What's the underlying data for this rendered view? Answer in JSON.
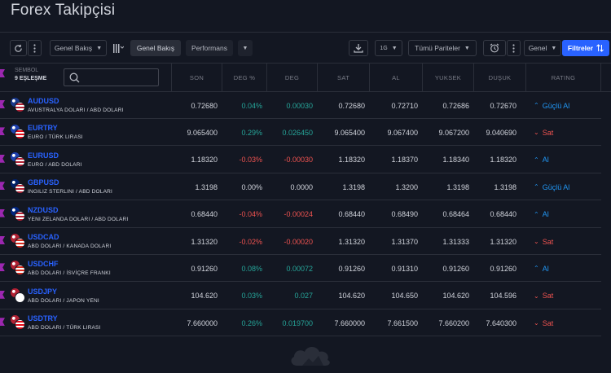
{
  "title": "Forex Takipçisi",
  "toolbar": {
    "view_select": "Genel Bakış",
    "tab_overview": "Genel Bakış",
    "tab_performance": "Performans",
    "interval": "1G",
    "pairs_select": "Tümü Pariteler",
    "general_select": "Genel",
    "filters_button": "Filtreler"
  },
  "table": {
    "symbol_header_top": "SEMBOL",
    "symbol_count": "9 EŞLEŞME",
    "search_placeholder": "",
    "columns": [
      "SON",
      "DEG %",
      "DEG",
      "SAT",
      "AL",
      "YUKSEK",
      "DUŞUK",
      "RATING"
    ],
    "rows": [
      {
        "symbol": "AUDUSD",
        "desc": "AVUSTRALYA DOLARI / ABD DOLARI",
        "son": "0.72680",
        "deg_pct": "0.04%",
        "deg": "0.00030",
        "sat": "0.72680",
        "al": "0.72710",
        "yuksek": "0.72686",
        "dusuk": "0.72670",
        "rating": "Güçlü Al",
        "dir": "pos",
        "rating_kind": "buy",
        "flag1": "#1a3a8c",
        "flag2": "#b22234"
      },
      {
        "symbol": "EURTRY",
        "desc": "EURO / TÜRK LIRASI",
        "son": "9.065400",
        "deg_pct": "0.29%",
        "deg": "0.026450",
        "sat": "9.065400",
        "al": "9.067400",
        "yuksek": "9.067200",
        "dusuk": "9.040690",
        "rating": "Sat",
        "dir": "pos",
        "rating_kind": "sell",
        "flag1": "#1e40af",
        "flag2": "#e30a17"
      },
      {
        "symbol": "EURUSD",
        "desc": "EURO / ABD DOLARI",
        "son": "1.18320",
        "deg_pct": "-0.03%",
        "deg": "-0.00030",
        "sat": "1.18320",
        "al": "1.18370",
        "yuksek": "1.18340",
        "dusuk": "1.18320",
        "rating": "Al",
        "dir": "neg",
        "rating_kind": "buy",
        "flag1": "#1e40af",
        "flag2": "#b22234"
      },
      {
        "symbol": "GBPUSD",
        "desc": "INGILIZ STERLINI / ABD DOLARI",
        "son": "1.3198",
        "deg_pct": "0.00%",
        "deg": "0.0000",
        "sat": "1.3198",
        "al": "1.3200",
        "yuksek": "1.3198",
        "dusuk": "1.3198",
        "rating": "Güçlü Al",
        "dir": "flat",
        "rating_kind": "buy",
        "flag1": "#012169",
        "flag2": "#b22234"
      },
      {
        "symbol": "NZDUSD",
        "desc": "YENI ZELANDA DOLARI / ABD DOLARI",
        "son": "0.68440",
        "deg_pct": "-0.04%",
        "deg": "-0.00024",
        "sat": "0.68440",
        "al": "0.68490",
        "yuksek": "0.68464",
        "dusuk": "0.68440",
        "rating": "Al",
        "dir": "neg",
        "rating_kind": "buy",
        "flag1": "#00247d",
        "flag2": "#b22234"
      },
      {
        "symbol": "USDCAD",
        "desc": "ABD DOLARI / KANADA DOLARI",
        "son": "1.31320",
        "deg_pct": "-0.02%",
        "deg": "-0.00020",
        "sat": "1.31320",
        "al": "1.31370",
        "yuksek": "1.31333",
        "dusuk": "1.31320",
        "rating": "Sat",
        "dir": "neg",
        "rating_kind": "sell",
        "flag1": "#b22234",
        "flag2": "#d52b1e"
      },
      {
        "symbol": "USDCHF",
        "desc": "ABD DOLARI / İSVİÇRE FRANKI",
        "son": "0.91260",
        "deg_pct": "0.08%",
        "deg": "0.00072",
        "sat": "0.91260",
        "al": "0.91310",
        "yuksek": "0.91260",
        "dusuk": "0.91260",
        "rating": "Al",
        "dir": "pos",
        "rating_kind": "buy",
        "flag1": "#b22234",
        "flag2": "#d52b1e"
      },
      {
        "symbol": "USDJPY",
        "desc": "ABD DOLARI / JAPON YENI",
        "son": "104.620",
        "deg_pct": "0.03%",
        "deg": "0.027",
        "sat": "104.620",
        "al": "104.650",
        "yuksek": "104.620",
        "dusuk": "104.596",
        "rating": "Sat",
        "dir": "pos",
        "rating_kind": "sell",
        "flag1": "#b22234",
        "flag2": "#ffffff"
      },
      {
        "symbol": "USDTRY",
        "desc": "ABD DOLARI / TÜRK LIRASI",
        "son": "7.660000",
        "deg_pct": "0.26%",
        "deg": "0.019700",
        "sat": "7.660000",
        "al": "7.661500",
        "yuksek": "7.660200",
        "dusuk": "7.640300",
        "rating": "Sat",
        "dir": "pos",
        "rating_kind": "sell",
        "flag1": "#b22234",
        "flag2": "#e30a17"
      }
    ]
  },
  "colors": {
    "background": "#131722",
    "accent": "#2962ff",
    "positive": "#26a69a",
    "negative": "#ef5350",
    "buy_rating": "#2196f3",
    "watchlist_marker": "#9c27b0"
  }
}
